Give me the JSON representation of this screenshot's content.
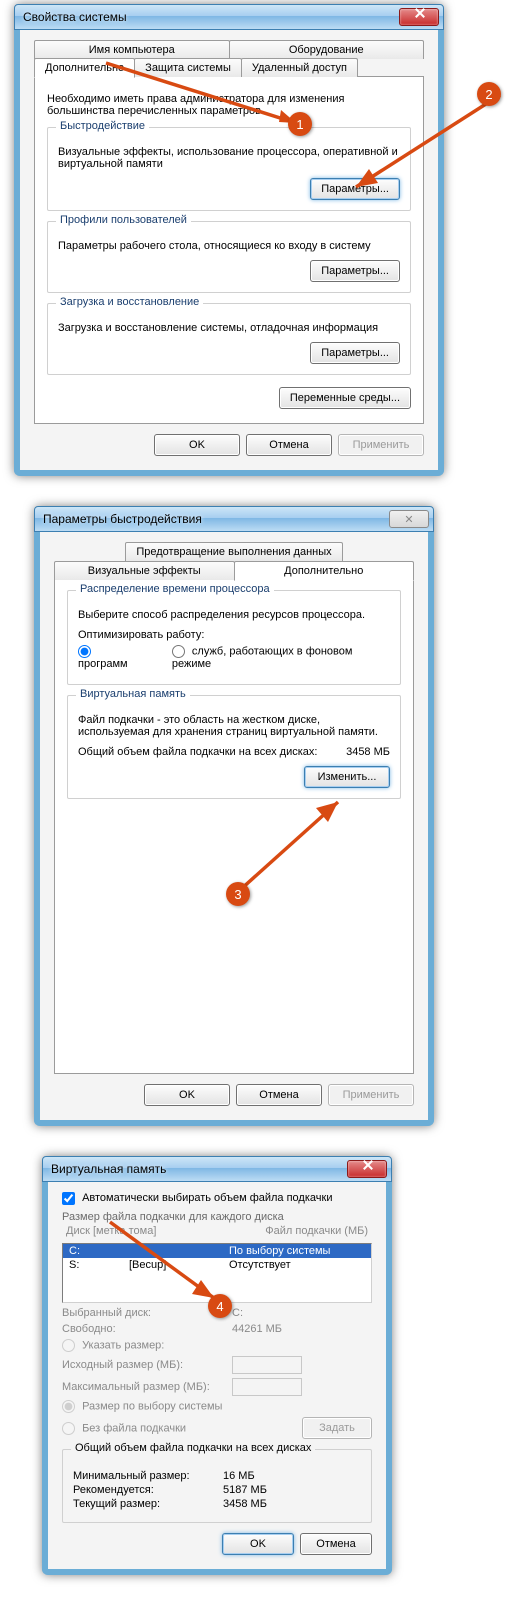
{
  "markers": {
    "m1": "1",
    "m2": "2",
    "m3": "3",
    "m4": "4"
  },
  "win1": {
    "title": "Свойства системы",
    "tabs_top": [
      "Имя компьютера",
      "Оборудование"
    ],
    "tabs_bottom": [
      "Дополнительно",
      "Защита системы",
      "Удаленный доступ"
    ],
    "intro": "Необходимо иметь права администратора для изменения большинства перечисленных параметров.",
    "g_perf_title": "Быстродействие",
    "g_perf_desc": "Визуальные эффекты, использование процессора, оперативной и виртуальной памяти",
    "btn_params": "Параметры...",
    "g_prof_title": "Профили пользователей",
    "g_prof_desc": "Параметры рабочего стола, относящиеся ко входу в систему",
    "g_boot_title": "Загрузка и восстановление",
    "g_boot_desc": "Загрузка и восстановление системы, отладочная информация",
    "btn_env": "Переменные среды...",
    "btn_ok": "OK",
    "btn_cancel": "Отмена",
    "btn_apply": "Применить"
  },
  "win2": {
    "title": "Параметры быстродействия",
    "tab_extra": "Предотвращение выполнения данных",
    "tab_vfx": "Визуальные эффекты",
    "tab_adv": "Дополнительно",
    "g_cpu_title": "Распределение времени процессора",
    "g_cpu_desc": "Выберите способ распределения ресурсов процессора.",
    "opt_label": "Оптимизировать работу:",
    "opt1": "программ",
    "opt2": "служб, работающих в фоновом режиме",
    "g_vm_title": "Виртуальная память",
    "g_vm_desc": "Файл подкачки - это область на жестком диске, используемая для хранения страниц виртуальной памяти.",
    "vm_total_label": "Общий объем файла подкачки на всех дисках:",
    "vm_total_value": "3458 МБ",
    "btn_change": "Изменить...",
    "btn_ok": "OK",
    "btn_cancel": "Отмена",
    "btn_apply": "Применить"
  },
  "win3": {
    "title": "Виртуальная память",
    "chk_auto": "Автоматически выбирать объем файла подкачки",
    "list_caption": "Размер файла подкачки для каждого диска",
    "hdr_disk": "Диск [метка тома]",
    "hdr_pf": "Файл подкачки (МБ)",
    "row1_c1": "C:",
    "row1_c2": "",
    "row1_c3": "По выбору системы",
    "row2_c1": "S:",
    "row2_c2": "[Becup]",
    "row2_c3": "Отсутствует",
    "sel_disk_label": "Выбранный диск:",
    "sel_disk_value": "C:",
    "free_label": "Свободно:",
    "free_value": "44261 МБ",
    "opt_custom": "Указать размер:",
    "initial_label": "Исходный размер (МБ):",
    "max_label": "Максимальный размер (МБ):",
    "opt_system": "Размер по выбору системы",
    "opt_none": "Без файла подкачки",
    "btn_set": "Задать",
    "summary_title": "Общий объем файла подкачки на всех дисках",
    "min_label": "Минимальный размер:",
    "min_value": "16 МБ",
    "rec_label": "Рекомендуется:",
    "rec_value": "5187 МБ",
    "cur_label": "Текущий размер:",
    "cur_value": "3458 МБ",
    "btn_ok": "OK",
    "btn_cancel": "Отмена"
  }
}
